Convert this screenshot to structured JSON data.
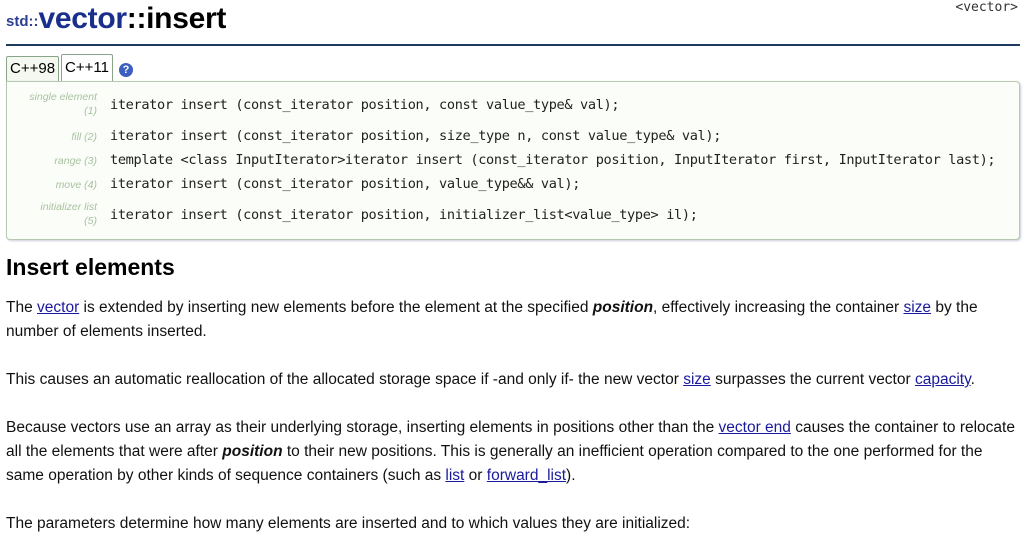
{
  "header": {
    "namespace": "std::",
    "class_name": "vector",
    "separator": "::",
    "member": "insert",
    "include": "<vector>"
  },
  "tabs": [
    {
      "label": "C++98",
      "active": false
    },
    {
      "label": "C++11",
      "active": true
    }
  ],
  "help_icon": "?",
  "prototypes": [
    {
      "label_line1": "single element",
      "label_line2": "(1)",
      "code": "iterator insert (const_iterator position, const value_type& val);"
    },
    {
      "label_line1": "fill (2)",
      "label_line2": "",
      "code": "iterator insert (const_iterator position, size_type n, const value_type& val);"
    },
    {
      "label_line1": "range (3)",
      "label_line2": "",
      "code": "template <class InputIterator>iterator insert (const_iterator position, InputIterator first, InputIterator last);"
    },
    {
      "label_line1": "move (4)",
      "label_line2": "",
      "code": "iterator insert (const_iterator position, value_type&& val);"
    },
    {
      "label_line1": "initializer list",
      "label_line2": "(5)",
      "code": "iterator insert (const_iterator position, initializer_list<value_type> il);"
    }
  ],
  "section_title": "Insert elements",
  "paragraphs": {
    "p1": {
      "t1": "The ",
      "l1": "vector",
      "t2": " is extended by inserting new elements before the element at the specified ",
      "b1": "position",
      "t3": ", effectively increasing the container ",
      "l2": "size",
      "t4": " by the number of elements inserted."
    },
    "p2": {
      "t1": "This causes an automatic reallocation of the allocated storage space if -and only if- the new vector ",
      "l1": "size",
      "t2": " surpasses the current vector ",
      "l2": "capacity",
      "t3": "."
    },
    "p3": {
      "t1": "Because vectors use an array as their underlying storage, inserting elements in positions other than the ",
      "l1": "vector end",
      "t2": " causes the container to relocate all the elements that were after ",
      "b1": "position",
      "t3": " to their new positions. This is generally an inefficient operation compared to the one performed for the same operation by other kinds of sequence containers (such as ",
      "l2": "list",
      "t4": " or ",
      "l3": "forward_list",
      "t5": ")."
    },
    "p4": {
      "t1": "The parameters determine how many elements are inserted and to which values they are initialized:"
    }
  }
}
